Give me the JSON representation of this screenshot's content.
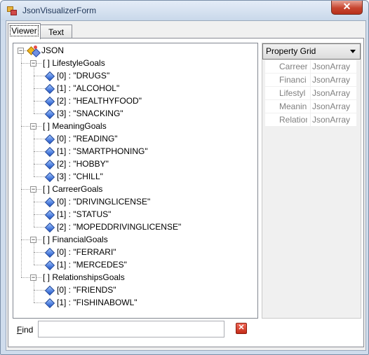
{
  "window": {
    "title": "JsonVisualizerForm",
    "close_glyph": "✕"
  },
  "tabs": [
    {
      "label": "Viewer",
      "active": true
    },
    {
      "label": "Text",
      "active": false
    }
  ],
  "tree": {
    "root": "JSON",
    "groups": [
      {
        "label": "[ ]  LifestyleGoals",
        "items": [
          "[0] : \"DRUGS\"",
          "[1] : \"ALCOHOL\"",
          "[2] : \"HEALTHYFOOD\"",
          "[3] : \"SNACKING\""
        ]
      },
      {
        "label": "[ ]  MeaningGoals",
        "items": [
          "[0] : \"READING\"",
          "[1] : \"SMARTPHONING\"",
          "[2] : \"HOBBY\"",
          "[3] : \"CHILL\""
        ]
      },
      {
        "label": "[ ]  CarreerGoals",
        "items": [
          "[0] : \"DRIVINGLICENSE\"",
          "[1] : \"STATUS\"",
          "[2] : \"MOPEDDRIVINGLICENSE\""
        ]
      },
      {
        "label": "[ ]  FinancialGoals",
        "items": [
          "[0] : \"FERRARI\"",
          "[1] : \"MERCEDES\""
        ]
      },
      {
        "label": "[ ]  RelationshipsGoals",
        "items": [
          "[0] : \"FRIENDS\"",
          "[1] : \"FISHINABOWL\""
        ]
      }
    ]
  },
  "property_grid": {
    "selector": "Property Grid",
    "rows": [
      {
        "name": "Carreer",
        "value": "JsonArray"
      },
      {
        "name": "Financi",
        "value": "JsonArray"
      },
      {
        "name": "Lifestyl",
        "value": "JsonArray"
      },
      {
        "name": "Meanin",
        "value": "JsonArray"
      },
      {
        "name": "Relation",
        "value": "JsonArray"
      }
    ]
  },
  "find": {
    "label_prefix": "",
    "label_accel": "F",
    "label_rest": "ind",
    "value": "",
    "clear_glyph": "✕"
  },
  "icons": {
    "app": "app-icon",
    "root": "json-root-icon",
    "item": "value-gem-icon",
    "clear": "clear-search-icon"
  },
  "colors": {
    "close_button": "#c7452f",
    "gem": "#1a52c9",
    "clear_button": "#c42b18"
  }
}
